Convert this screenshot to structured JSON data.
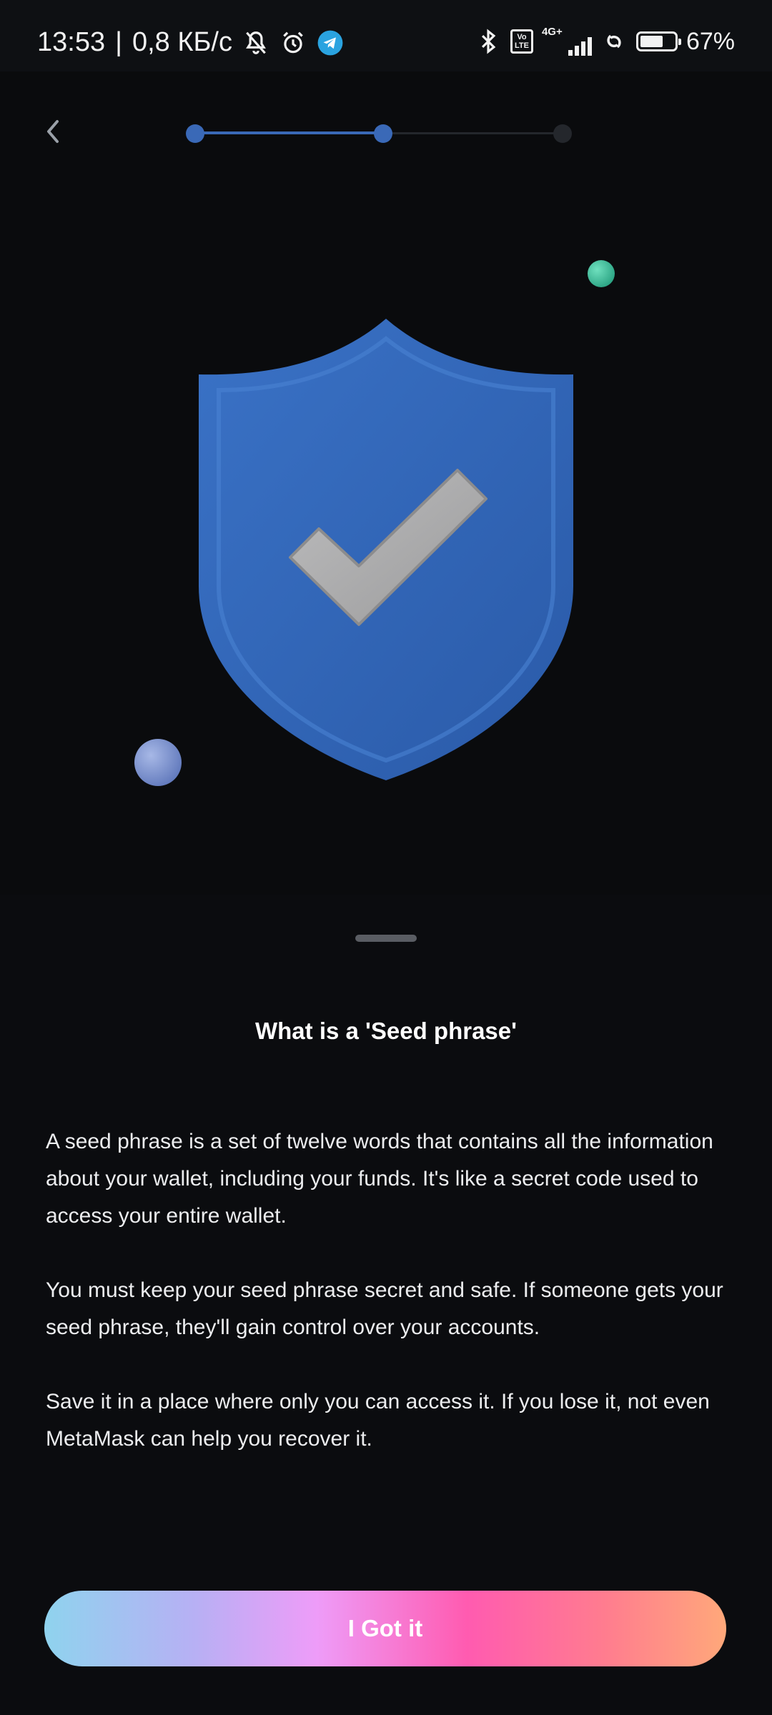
{
  "status_bar": {
    "time": "13:53",
    "separator": "|",
    "network_speed": "0,8 КБ/с",
    "volte_label": "Vo LTE",
    "network_type": "4G+",
    "battery_percent": "67%",
    "battery_level": 0.67,
    "icons": [
      "bell-off-icon",
      "alarm-icon",
      "telegram-icon",
      "bluetooth-icon",
      "volte-icon",
      "signal-icon",
      "hotspot-icon",
      "battery-icon"
    ]
  },
  "header": {
    "back_icon": "chevron-left-icon",
    "progress": {
      "steps": 3,
      "current_step": 2
    }
  },
  "illustration": {
    "main_icon": "shield-check-icon",
    "colors": {
      "shield": "#2f63b5",
      "check": "#a9a9aa",
      "bubble_green": "#2fbf97",
      "bubble_blue": "#7f95d6"
    }
  },
  "sheet": {
    "title": "What is a 'Seed phrase'",
    "paragraphs": [
      "A seed phrase is a set of twelve words that contains all the information about your wallet, including your funds. It's like a secret code used to access your entire wallet.",
      "You must keep your seed phrase secret and safe. If someone gets your seed phrase, they'll gain control over your accounts.",
      "Save it in a place where only you can access it. If you lose it, not even MetaMask can help you recover it."
    ],
    "button_label": "I Got it"
  },
  "colors": {
    "background": "#0a0b0d",
    "progress_active": "#3a69b7",
    "progress_inactive": "#24272c"
  }
}
